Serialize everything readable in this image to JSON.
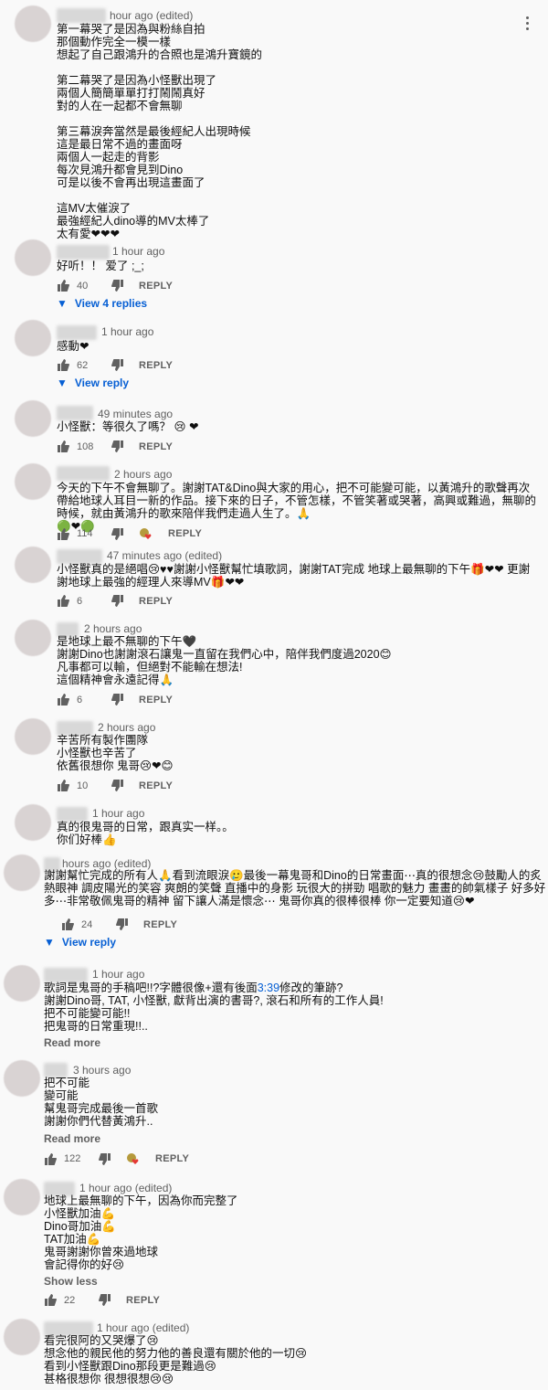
{
  "comments": [
    {
      "time": "hour ago (edited)",
      "lines": [
        "第一幕哭了是因為與粉絲自拍",
        "那個動作完全一模一樣",
        "想起了自己跟鴻升的合照也是鴻升寶鏡的",
        "",
        "第二幕哭了是因為小怪獸出現了",
        "兩個人簡簡單單打打鬧鬧真好",
        "對的人在一起都不會無聊",
        "",
        "第三幕淚奔當然是最後經紀人出現時候",
        "這是最日常不過的畫面呀",
        "兩個人一起走的背影",
        "每次見鴻升都會見到Dino",
        "可是以後不會再出現這畫面了",
        "",
        "這MV太催淚了",
        "最強經紀人dino導的MV太棒了",
        "太有愛❤❤❤"
      ]
    },
    {
      "time": "1 hour ago",
      "lines": [
        "好听！！ 爱了 ;_;"
      ],
      "likes": "40",
      "reply": "REPLY",
      "replies": "View 4 replies"
    },
    {
      "time": "1 hour ago",
      "lines": [
        "感動❤"
      ],
      "likes": "62",
      "reply": "REPLY",
      "replies": "View reply"
    },
    {
      "time": "49 minutes ago",
      "lines": [
        "小怪獸：等很久了嗎？ 😢 ❤"
      ],
      "likes": "108",
      "reply": "REPLY"
    },
    {
      "time": "2 hours ago",
      "lines": [
        "今天的下午不會無聊了。謝謝TAT&Dino與大家的用心，把不可能變可能，以黃鴻升的歌聲再次帶給地球人耳目一新的作品。接下來的日子，不管怎樣，不管笑著或哭著，高興或難過，無聊的時候，就由黃鴻升的歌來陪伴我們走過人生了。🙏",
        "🟢❤🟢"
      ],
      "likes": "114",
      "reply": "REPLY"
    },
    {
      "time": "47 minutes ago (edited)",
      "lines": [
        "小怪獸真的是絕唱😢♥♥謝謝小怪獸幫忙填歌詞，謝謝TAT完成 地球上最無聊的下午🎁❤❤ 更謝謝地球上最強的經理人來導MV🎁❤❤"
      ],
      "likes": "6",
      "reply": "REPLY"
    },
    {
      "time": "2 hours ago",
      "lines": [
        "是地球上最不無聊的下午🖤",
        "謝謝Dino也謝謝滾石讓鬼一直留在我們心中，陪伴我們度過2020😊",
        "凡事都可以輸，但絕對不能輸在想法!",
        "這個精神會永遠記得🙏"
      ],
      "likes": "6",
      "reply": "REPLY"
    },
    {
      "time": "2 hours ago",
      "lines": [
        "辛苦所有製作團隊",
        "小怪獸也辛苦了",
        "依舊很想你 鬼哥😢❤😊"
      ],
      "likes": "10",
      "reply": "REPLY"
    },
    {
      "time": "1 hour ago",
      "lines": [
        "真的很鬼哥的日常，跟真实一样。。",
        "你们好棒👍"
      ]
    },
    {
      "time": "hours ago (edited)",
      "lines": [
        "謝謝幫忙完成的所有人🙏看到流眼淚🥲最後一幕鬼哥和Dino的日常畫面⋯真的很想念😢鼓勵人的炙熱眼神 調皮陽光的笑容 爽朗的笑聲 直播中的身影 玩很大的拼勁 唱歌的魅力 畫畫的帥氣樣子 好多好多⋯非常敬佩鬼哥的精神 留下讓人滿是懷念⋯ 鬼哥你真的很棒很棒 你一定要知道😢❤"
      ],
      "likes": "24",
      "reply": "REPLY",
      "replies": "View reply"
    },
    {
      "time": "1 hour ago",
      "lines": [
        "歌詞是鬼哥的手稿吧!!?字體很像+還有後面",
        "謝謝Dino哥, TAT, 小怪獸, 獻背出演的書哥?, 滾石和所有的工作人員!",
        "把不可能變可能!!",
        "把鬼哥的日常重現!!.."
      ],
      "ts": "3:39",
      "ts_after": "修改的筆跡?",
      "more": "Read more"
    },
    {
      "time": "3 hours ago",
      "lines": [
        "把不可能",
        "變可能",
        "幫鬼哥完成最後一首歌",
        "謝謝你們代替黃鴻升.."
      ],
      "more": "Read more",
      "likes": "122",
      "reply": "REPLY"
    },
    {
      "time": "1 hour ago (edited)",
      "lines": [
        "地球上最無聊的下午，因為你而完整了",
        "小怪獸加油💪",
        "Dino哥加油💪",
        "TAT加油💪",
        "鬼哥謝謝你曾來過地球",
        "會記得你的好😢"
      ],
      "more": "Show less",
      "likes": "22",
      "reply": "REPLY"
    },
    {
      "time": "1 hour ago (edited)",
      "lines": [
        "看完很阿的又哭爆了😢",
        "想念他的親民他的努力他的善良還有關於他的一切😢",
        "看到小怪獸跟Dino那段更是難過😢",
        "甚格很想你 很想很想😢😢"
      ]
    }
  ],
  "colors": {
    "link": "#065fd4",
    "text": "#0f0f0f",
    "meta": "#606060"
  }
}
